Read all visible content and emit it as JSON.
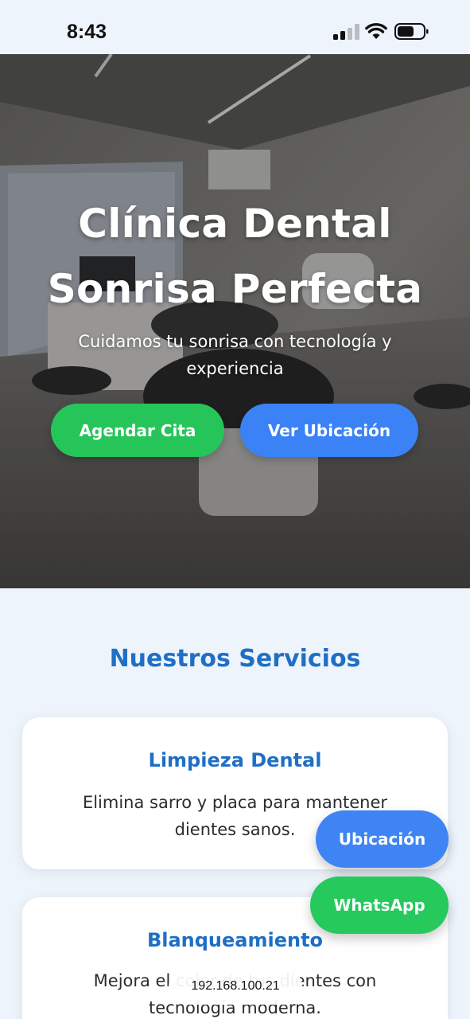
{
  "status_bar": {
    "time": "8:43"
  },
  "hero": {
    "title_line1": "Clínica Dental",
    "title_line2": "Sonrisa Perfecta",
    "subtitle": "Cuidamos tu sonrisa con tecnología y experiencia",
    "primary_button": "Agendar Cita",
    "secondary_button": "Ver Ubicación"
  },
  "services": {
    "title": "Nuestros Servicios",
    "items": [
      {
        "title": "Limpieza Dental",
        "description": "Elimina sarro y placa para mantener dientes sanos."
      },
      {
        "title": "Blanqueamiento",
        "description": "Mejora el color de tus dientes con tecnología moderna."
      }
    ]
  },
  "floating": {
    "location_label": "Ubicación",
    "whatsapp_label": "WhatsApp"
  },
  "browser": {
    "url": "192.168.100.21"
  },
  "colors": {
    "accent_blue": "#3b82f6",
    "accent_green": "#26c55a",
    "heading_blue": "#1f6fc4",
    "page_background": "#eef4fb"
  },
  "icons": [
    "signal-icon",
    "wifi-icon",
    "battery-icon"
  ]
}
